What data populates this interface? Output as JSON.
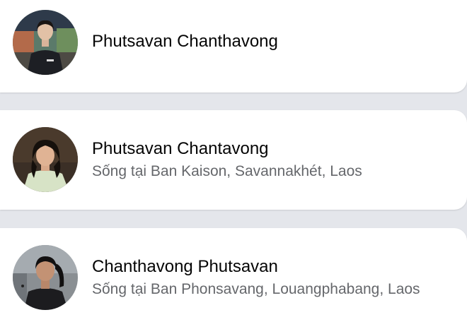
{
  "results": [
    {
      "name": "Phutsavan Chanthavong",
      "subtitle": ""
    },
    {
      "name": "Phutsavan Chantavong",
      "subtitle": "Sống tại Ban Kaison, Savannakhét, Laos"
    },
    {
      "name": "Chanthavong Phutsavan",
      "subtitle": "Sống tại Ban Phonsavang, Louangphabang, Laos"
    }
  ],
  "colors": {
    "background": "#e4e6eb",
    "card": "#ffffff",
    "name_text": "#050505",
    "secondary_text": "#65676b"
  },
  "icons": [
    "profile-avatar-1",
    "profile-avatar-2",
    "profile-avatar-3"
  ]
}
